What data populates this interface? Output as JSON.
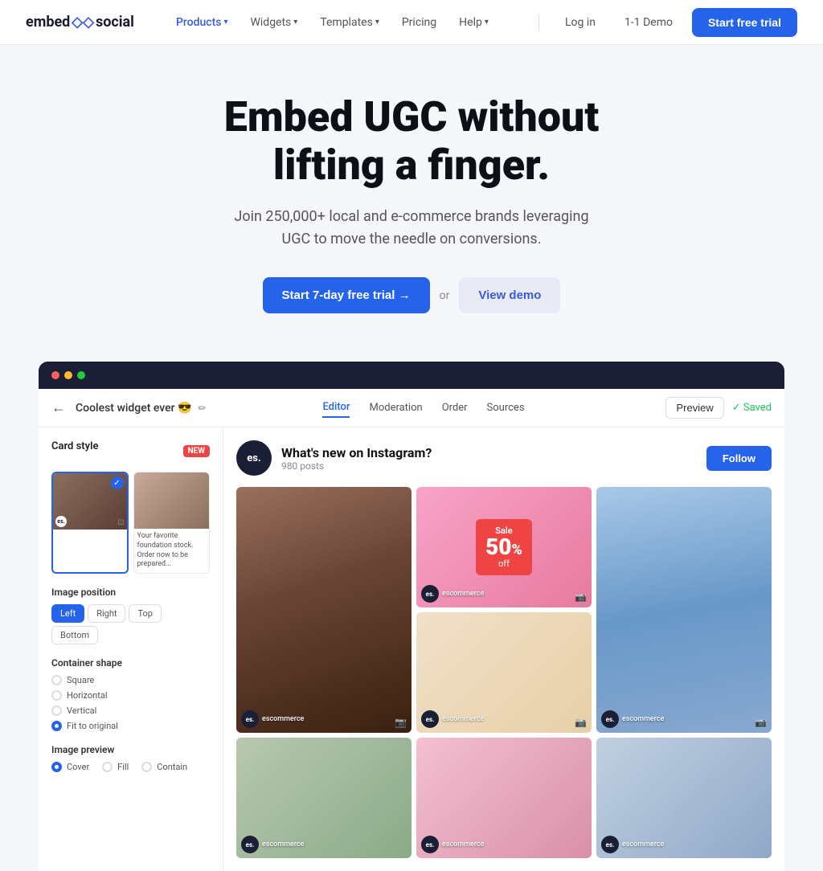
{
  "nav": {
    "logo": "embed",
    "logo_arrows": "◇◇",
    "logo_suffix": "social",
    "links": [
      {
        "label": "Products",
        "active": false,
        "has_dropdown": true
      },
      {
        "label": "Widgets",
        "active": false,
        "has_dropdown": true
      },
      {
        "label": "Templates",
        "active": false,
        "has_dropdown": true
      },
      {
        "label": "Pricing",
        "active": false,
        "has_dropdown": false
      },
      {
        "label": "Help",
        "active": false,
        "has_dropdown": true
      }
    ],
    "login": "Log in",
    "demo": "1-1 Demo",
    "cta": "Start free trial"
  },
  "hero": {
    "headline_line1": "Embed UGC without",
    "headline_line2": "lifting a finger.",
    "subtext": "Join 250,000+ local and e-commerce brands leveraging UGC to move the needle on conversions.",
    "btn_trial": "Start 7-day free trial →",
    "btn_demo": "View demo",
    "or_text": "or"
  },
  "mockup": {
    "dots": [
      "red",
      "yellow",
      "green"
    ],
    "header": {
      "back_icon": "←",
      "title": "Coolest widget ever 😎",
      "edit_icon": "✏",
      "tabs": [
        "Editor",
        "Moderation",
        "Order",
        "Sources"
      ],
      "active_tab": "Editor",
      "preview_btn": "Preview",
      "saved_text": "✓ Saved"
    },
    "feed": {
      "avatar_text": "es.",
      "title": "What's new on Instagram?",
      "posts": "980 posts",
      "follow_btn": "Follow"
    },
    "left_panel": {
      "card_style_label": "Card style",
      "new_badge": "NEW",
      "image_position_label": "Image position",
      "image_position_options": [
        "Left",
        "Right",
        "Top",
        "Bottom"
      ],
      "active_position": "Left",
      "container_shape_label": "Container shape",
      "container_shapes": [
        "Square",
        "Horizontal",
        "Vertical",
        "Fit to original"
      ],
      "active_shape": "Fit to original",
      "image_preview_label": "Image preview",
      "image_preview_options": [
        "Cover",
        "Fill",
        "Contain"
      ],
      "active_preview": "Cover"
    },
    "grid_items": [
      {
        "type": "portrait",
        "name": "escommerce",
        "col": 1,
        "row": 1,
        "span": 2
      },
      {
        "type": "sale",
        "name": "escommerce",
        "col": 2,
        "row": 1
      },
      {
        "type": "fashion",
        "name": "escommerce",
        "col": 3,
        "row": 1,
        "span": 2
      },
      {
        "type": "shoes",
        "name": "escommerce",
        "col": 2,
        "row": 2
      },
      {
        "type": "flowers",
        "name": "escommerce",
        "col": 1,
        "row": 3
      },
      {
        "type": "store",
        "name": "escommerce",
        "col": 2,
        "row": 3
      },
      {
        "type": "fashion2",
        "name": "escommerce",
        "col": 3,
        "row": 3
      }
    ],
    "sale_text": "Sale",
    "sale_percent": "50",
    "sale_off": "off"
  }
}
